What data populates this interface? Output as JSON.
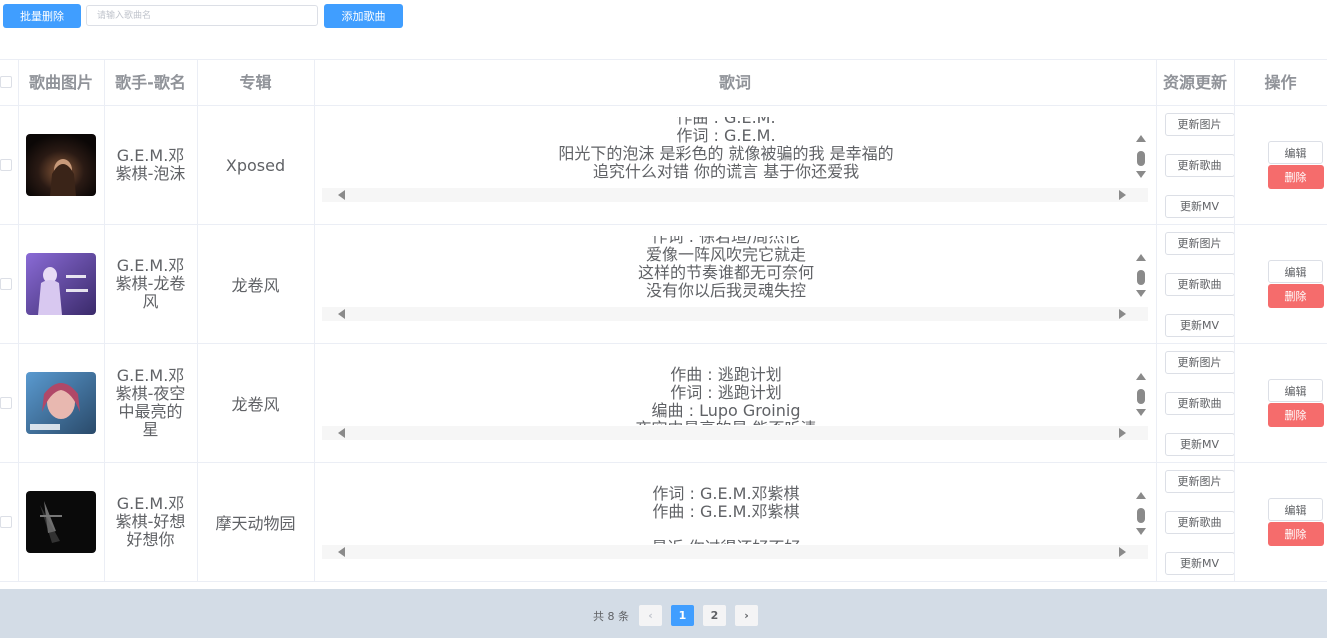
{
  "toolbar": {
    "batch_delete": "批量删除",
    "search_placeholder": "请输入歌曲名",
    "add_song": "添加歌曲"
  },
  "table": {
    "headers": {
      "image": "歌曲图片",
      "artist_song": "歌手-歌名",
      "album": "专辑",
      "lyrics": "歌词",
      "resource_update": "资源更新",
      "actions": "操作"
    },
    "resource_buttons": {
      "update_image": "更新图片",
      "update_song": "更新歌曲",
      "update_mv": "更新MV"
    },
    "action_buttons": {
      "edit": "编辑",
      "delete": "删除"
    },
    "rows": [
      {
        "artist_song": "G.E.M.邓紫棋-泡沫",
        "album": "Xposed",
        "lyrics": "作曲 : G.E.M.\n作词 : G.E.M.\n阳光下的泡沫 是彩色的 就像被骗的我 是幸福的\n追究什么对错 你的谎言 基于你还爱我"
      },
      {
        "artist_song": "G.E.M.邓紫棋-龙卷风",
        "album": "龙卷风",
        "lyrics": "作词 : 徐若瑄/周杰伦\n爱像一阵风吹完它就走\n这样的节奏谁都无可奈何\n没有你以后我灵魂失控"
      },
      {
        "artist_song": "G.E.M.邓紫棋-夜空中最亮的星",
        "album": "龙卷风",
        "lyrics": "作曲 : 逃跑计划\n作词 : 逃跑计划\n编曲 : Lupo Groinig\n夜空中最亮的星 能否听清"
      },
      {
        "artist_song": "G.E.M.邓紫棋-好想好想你",
        "album": "摩天动物园",
        "lyrics": "作词 : G.E.M.邓紫棋\n作曲 : G.E.M.邓紫棋\n\n最近 你过得还好不好"
      }
    ]
  },
  "pagination": {
    "total": "共 8 条",
    "prev": "‹",
    "next": "›",
    "pages": [
      "1",
      "2"
    ]
  }
}
